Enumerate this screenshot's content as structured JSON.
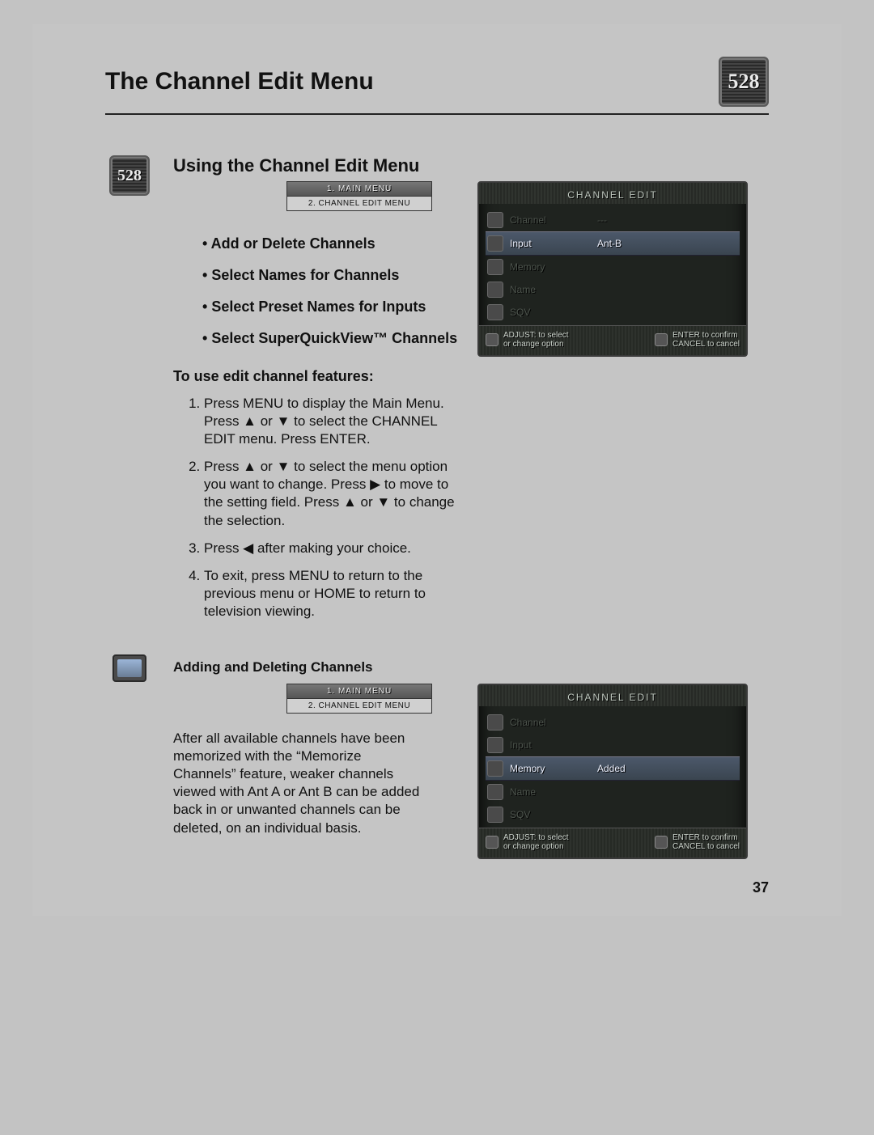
{
  "chip_label": "528",
  "page_number": "37",
  "page_title": "The Channel Edit Menu",
  "section1": {
    "heading": "Using the Channel Edit Menu",
    "breadcrumb": {
      "line1": "1. MAIN MENU",
      "line2": "2. CHANNEL EDIT MENU"
    },
    "bullets": [
      "Add or Delete Channels",
      "Select Names for Channels",
      "Select Preset Names for Inputs",
      "Select SuperQuickView™ Channels"
    ],
    "howto_title": "To use edit channel features:",
    "steps": [
      "Press MENU to display the Main Menu. Press ▲ or ▼ to select the CHANNEL EDIT menu. Press ENTER.",
      "Press ▲ or ▼ to select the menu option you want to change. Press ▶ to move to the setting field. Press ▲ or ▼ to change the selection.",
      "Press ◀ after making your choice.",
      "To exit, press MENU to return to the previous menu or HOME to return to television viewing."
    ],
    "osd": {
      "title": "CHANNEL EDIT",
      "rows": [
        {
          "icon": "channel-icon",
          "label": "Channel",
          "value": "---",
          "faded": true
        },
        {
          "icon": "input-icon",
          "label": "Input",
          "value": "Ant-B",
          "highlight": true
        },
        {
          "icon": "memory-icon",
          "label": "Memory",
          "value": "",
          "faded": true
        },
        {
          "icon": "name-icon",
          "label": "Name",
          "value": "",
          "faded": true
        },
        {
          "icon": "sqv-icon",
          "label": "SQV",
          "value": "",
          "faded": true
        }
      ],
      "footer": {
        "left_top": "ADJUST: to select",
        "left_bottom": "or change option",
        "right_top": "ENTER to confirm",
        "right_bottom": "CANCEL to cancel"
      }
    }
  },
  "section2": {
    "heading": "Adding and Deleting Channels",
    "breadcrumb": {
      "line1": "1. MAIN MENU",
      "line2": "2. CHANNEL EDIT MENU"
    },
    "paragraph": "After all available channels have been memorized with the “Memorize Channels” feature, weaker channels viewed with Ant A or Ant B can be added back in or unwanted channels can be deleted, on an individual basis.",
    "osd": {
      "title": "CHANNEL EDIT",
      "rows": [
        {
          "icon": "channel-icon",
          "label": "Channel",
          "value": "",
          "faded": true
        },
        {
          "icon": "input-icon",
          "label": "Input",
          "value": "",
          "faded": true
        },
        {
          "icon": "memory-icon",
          "label": "Memory",
          "value": "Added",
          "highlight": true
        },
        {
          "icon": "name-icon",
          "label": "Name",
          "value": "",
          "faded": true
        },
        {
          "icon": "sqv-icon",
          "label": "SQV",
          "value": "",
          "faded": true
        }
      ],
      "footer": {
        "left_top": "ADJUST: to select",
        "left_bottom": "or change option",
        "right_top": "ENTER to confirm",
        "right_bottom": "CANCEL to cancel"
      }
    }
  }
}
